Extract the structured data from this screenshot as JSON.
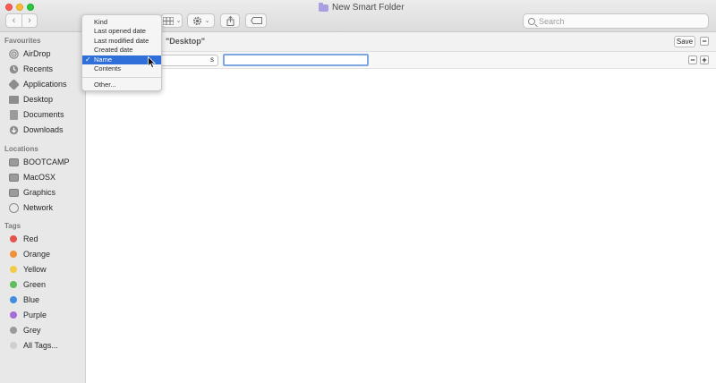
{
  "window": {
    "title": "New Smart Folder"
  },
  "toolbar": {
    "back_glyph": "‹",
    "forward_glyph": "›",
    "view_icon": "grid-view-icon",
    "action_icon": "gear-icon",
    "share_icon": "share-icon",
    "tag_icon": "tag-icon",
    "search_placeholder": "Search"
  },
  "sidebar": {
    "favourites_header": "Favourites",
    "favourites": [
      {
        "label": "AirDrop",
        "icon": "airdrop-icon"
      },
      {
        "label": "Recents",
        "icon": "recents-icon"
      },
      {
        "label": "Applications",
        "icon": "applications-icon"
      },
      {
        "label": "Desktop",
        "icon": "desktop-icon"
      },
      {
        "label": "Documents",
        "icon": "documents-icon"
      },
      {
        "label": "Downloads",
        "icon": "downloads-icon"
      }
    ],
    "locations_header": "Locations",
    "locations": [
      {
        "label": "BOOTCAMP",
        "icon": "disk-icon"
      },
      {
        "label": "MacOSX",
        "icon": "disk-icon"
      },
      {
        "label": "Graphics",
        "icon": "disk-icon"
      },
      {
        "label": "Network",
        "icon": "network-icon"
      }
    ],
    "tags_header": "Tags",
    "tags": [
      {
        "label": "Red",
        "color": "#e5534b"
      },
      {
        "label": "Orange",
        "color": "#f0913a"
      },
      {
        "label": "Yellow",
        "color": "#f2cb47"
      },
      {
        "label": "Green",
        "color": "#5fbf5a"
      },
      {
        "label": "Blue",
        "color": "#3f8ee0"
      },
      {
        "label": "Purple",
        "color": "#a86bd6"
      },
      {
        "label": "Grey",
        "color": "#9a9a9a"
      },
      {
        "label": "All Tags...",
        "color": "#cfcfcf"
      }
    ]
  },
  "search_scope": {
    "label": "\"Desktop\"",
    "save_label": "Save",
    "minus": "−",
    "plus": "+"
  },
  "criteria": {
    "attribute_visible_text": "s",
    "value": ""
  },
  "attribute_menu": {
    "items": [
      "Kind",
      "Last opened date",
      "Last modified date",
      "Created date",
      "Name",
      "Contents"
    ],
    "selected": "Name",
    "check_glyph": "✓",
    "other_label": "Other..."
  }
}
